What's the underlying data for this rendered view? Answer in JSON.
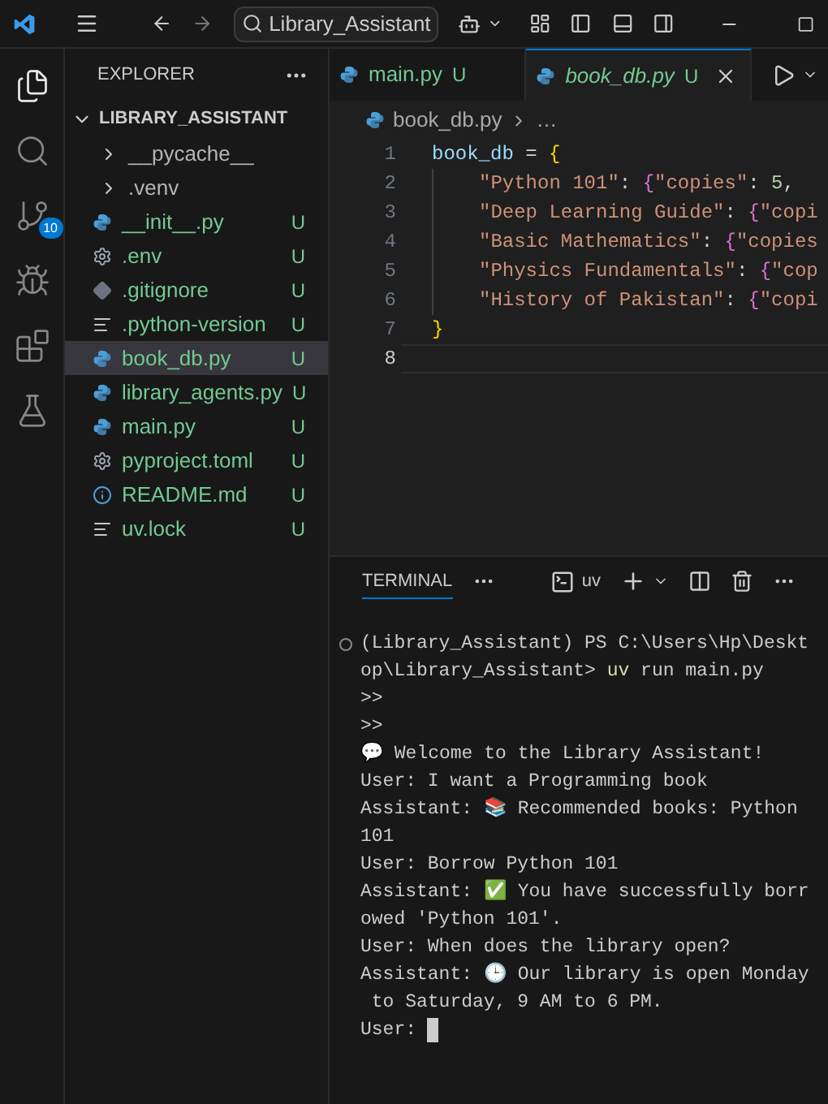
{
  "title_bar": {
    "search": "Library_Assistant"
  },
  "activity_bar": {
    "items": [
      {
        "kind": "explorer",
        "selected": true
      },
      {
        "kind": "search",
        "selected": false
      },
      {
        "kind": "source_control",
        "selected": false,
        "badge": "10"
      },
      {
        "kind": "run_debug",
        "selected": false
      },
      {
        "kind": "extensions",
        "selected": false
      },
      {
        "kind": "testing",
        "selected": false
      }
    ]
  },
  "explorer": {
    "title": "EXPLORER",
    "root": {
      "label": "LIBRARY_ASSISTANT",
      "expanded": true,
      "children": [
        {
          "label": "__pycache__",
          "kind": "folder",
          "expanded": false,
          "selected": false
        },
        {
          "label": ".venv",
          "kind": "folder",
          "expanded": false,
          "selected": false
        },
        {
          "label": "__init__.py",
          "kind": "python",
          "status": "U",
          "selected": false
        },
        {
          "label": ".env",
          "kind": "settings",
          "status": "U",
          "selected": false
        },
        {
          "label": ".gitignore",
          "kind": "git",
          "status": "U",
          "selected": false
        },
        {
          "label": ".python-version",
          "kind": "text",
          "status": "U",
          "selected": false
        },
        {
          "label": "book_db.py",
          "kind": "python",
          "status": "U",
          "selected": true
        },
        {
          "label": "library_agents.py",
          "kind": "python",
          "status": "U",
          "selected": false
        },
        {
          "label": "main.py",
          "kind": "python",
          "status": "U",
          "selected": false
        },
        {
          "label": "pyproject.toml",
          "kind": "settings",
          "status": "U",
          "selected": false
        },
        {
          "label": "README.md",
          "kind": "info",
          "status": "U",
          "selected": false
        },
        {
          "label": "uv.lock",
          "kind": "text",
          "status": "U",
          "selected": false
        }
      ]
    }
  },
  "tabs": [
    {
      "label": "main.py",
      "status": "U",
      "selected": false,
      "preview": false
    },
    {
      "label": "book_db.py",
      "status": "U",
      "selected": true,
      "preview": true
    }
  ],
  "breadcrumb": {
    "file": "book_db.py",
    "rest": "…"
  },
  "code": {
    "lines": [
      {
        "number": "1",
        "selected": false,
        "indented": false,
        "tokens": [
          {
            "text": "book_db",
            "kind": "var"
          },
          {
            "text": " = ",
            "kind": "op"
          },
          {
            "text": "{",
            "kind": "brace"
          }
        ]
      },
      {
        "number": "2",
        "selected": false,
        "indented": true,
        "tokens": [
          {
            "text": "\"Python 101\"",
            "kind": "string"
          },
          {
            "text": ": ",
            "kind": "op"
          },
          {
            "text": "{",
            "kind": "brace2"
          },
          {
            "text": "\"copies\"",
            "kind": "string"
          },
          {
            "text": ": ",
            "kind": "op"
          },
          {
            "text": "5",
            "kind": "number"
          },
          {
            "text": ",",
            "kind": "op"
          }
        ]
      },
      {
        "number": "3",
        "selected": false,
        "indented": true,
        "tokens": [
          {
            "text": "\"Deep Learning Guide\"",
            "kind": "string"
          },
          {
            "text": ": ",
            "kind": "op"
          },
          {
            "text": "{",
            "kind": "brace2"
          },
          {
            "text": "\"copi",
            "kind": "string"
          }
        ]
      },
      {
        "number": "4",
        "selected": false,
        "indented": true,
        "tokens": [
          {
            "text": "\"Basic Mathematics\"",
            "kind": "string"
          },
          {
            "text": ": ",
            "kind": "op"
          },
          {
            "text": "{",
            "kind": "brace2"
          },
          {
            "text": "\"copies",
            "kind": "string"
          }
        ]
      },
      {
        "number": "5",
        "selected": false,
        "indented": true,
        "tokens": [
          {
            "text": "\"Physics Fundamentals\"",
            "kind": "string"
          },
          {
            "text": ": ",
            "kind": "op"
          },
          {
            "text": "{",
            "kind": "brace2"
          },
          {
            "text": "\"cop",
            "kind": "string"
          }
        ]
      },
      {
        "number": "6",
        "selected": false,
        "indented": true,
        "tokens": [
          {
            "text": "\"History of Pakistan\"",
            "kind": "string"
          },
          {
            "text": ": ",
            "kind": "op"
          },
          {
            "text": "{",
            "kind": "brace2"
          },
          {
            "text": "\"copi",
            "kind": "string"
          }
        ]
      },
      {
        "number": "7",
        "selected": false,
        "indented": false,
        "tokens": [
          {
            "text": "}",
            "kind": "brace"
          }
        ]
      },
      {
        "number": "8",
        "selected": true,
        "indented": false
      }
    ]
  },
  "terminal": {
    "tab": "TERMINAL",
    "shell": "uv",
    "cursor": true,
    "lines": [
      [
        {
          "text": "(Library_Assistant) PS C:\\Users\\Hp\\Deskt",
          "kind": "plain"
        }
      ],
      [
        {
          "text": "op\\Library_Assistant> ",
          "kind": "plain"
        },
        {
          "text": "uv",
          "kind": "command"
        },
        {
          "text": " run main.py",
          "kind": "plain"
        }
      ],
      [
        {
          "text": ">>",
          "kind": "plain"
        }
      ],
      [
        {
          "text": ">>",
          "kind": "plain"
        }
      ],
      [
        {
          "text": "💬 Welcome to the Library Assistant!",
          "kind": "plain"
        }
      ],
      [
        {
          "text": "User: I want a Programming book",
          "kind": "plain"
        }
      ],
      [
        {
          "text": "Assistant: 📚 Recommended books: Python",
          "kind": "plain"
        }
      ],
      [
        {
          "text": "101",
          "kind": "plain"
        }
      ],
      [
        {
          "text": "User: Borrow Python 101",
          "kind": "plain"
        }
      ],
      [
        {
          "text": "Assistant: ✅ You have successfully borr",
          "kind": "plain"
        }
      ],
      [
        {
          "text": "owed 'Python 101'.",
          "kind": "plain"
        }
      ],
      [
        {
          "text": "User: When does the library open?",
          "kind": "plain"
        }
      ],
      [
        {
          "text": "Assistant: 🕒 Our library is open Monday",
          "kind": "plain"
        }
      ],
      [
        {
          "text": " to Saturday, 9 AM to 6 PM.",
          "kind": "plain"
        }
      ],
      [
        {
          "text": "User: ",
          "kind": "plain"
        }
      ]
    ]
  }
}
